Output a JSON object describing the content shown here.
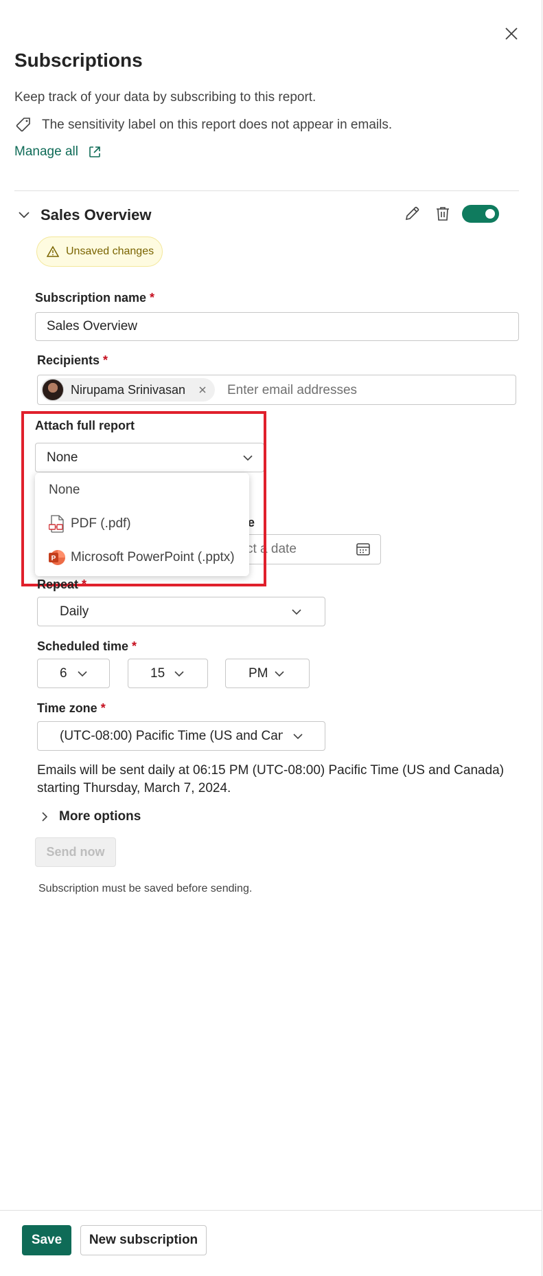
{
  "panel": {
    "title": "Subscriptions",
    "description": "Keep track of your data by subscribing to this report.",
    "sensitivity_note": "The sensitivity label on this report does not appear in emails.",
    "manage_all": "Manage all"
  },
  "subscription": {
    "name": "Sales Overview",
    "enabled": true,
    "unsaved_badge": "Unsaved changes",
    "toggle_color": "#0f7b5e"
  },
  "form": {
    "name_label": "Subscription name",
    "name_value": "Sales Overview",
    "recipients_label": "Recipients",
    "recipient_chip": "Nirupama Srinivasan",
    "recipients_placeholder": "Enter email addresses",
    "attach_label": "Attach full report",
    "attach_value": "None",
    "attach_options": [
      {
        "label": "None",
        "icon": ""
      },
      {
        "label": "PDF (.pdf)",
        "icon": "pdf-file-icon"
      },
      {
        "label": "Microsoft PowerPoint (.pptx)",
        "icon": "powerpoint-icon"
      }
    ],
    "end_date_label_visible": "ate",
    "end_date_placeholder_visible": "ct a date",
    "repeat_label": "Repeat",
    "repeat_value": "Daily",
    "scheduled_time_label": "Scheduled time",
    "hour": "6",
    "minute": "15",
    "ampm": "PM",
    "time_zone_label": "Time zone",
    "time_zone_value": "(UTC-08:00) Pacific Time (US and Canada)",
    "summary_line1": "Emails will be sent daily at 06:15 PM (UTC-08:00) Pacific Time (US and Canada)",
    "summary_line2": "starting Thursday, March 7, 2024.",
    "more_options": "More options",
    "send_now": "Send now",
    "send_hint": "Subscription must be saved before sending.",
    "required_mark": "*"
  },
  "footer": {
    "save": "Save",
    "new_subscription": "New subscription"
  },
  "colors": {
    "accent": "#0f6b57",
    "highlight": "#e0202c",
    "required": "#c50f1f"
  }
}
